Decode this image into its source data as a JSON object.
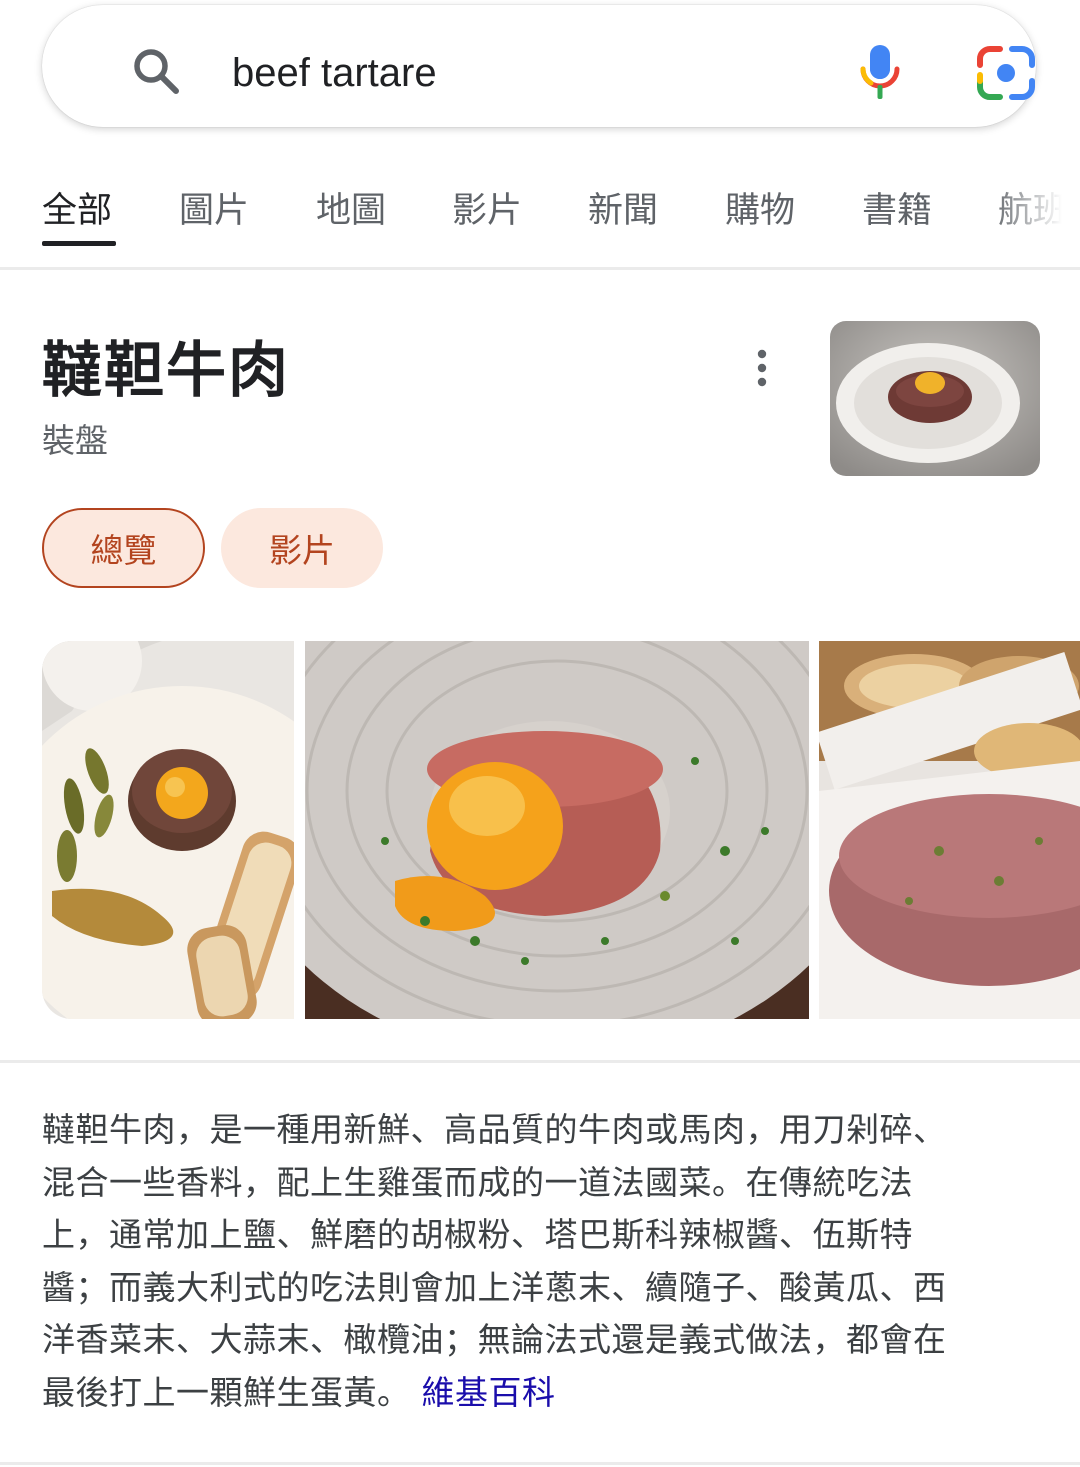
{
  "search": {
    "query": "beef tartare"
  },
  "tabs": [
    {
      "label": "全部",
      "active": true
    },
    {
      "label": "圖片"
    },
    {
      "label": "地圖"
    },
    {
      "label": "影片"
    },
    {
      "label": "新聞"
    },
    {
      "label": "購物"
    },
    {
      "label": "書籍"
    },
    {
      "label": "航班"
    }
  ],
  "knowledge_panel": {
    "title": "韃靼牛肉",
    "subtitle": "裝盤",
    "chips": [
      {
        "label": "總覽",
        "selected": true
      },
      {
        "label": "影片",
        "selected": false
      }
    ],
    "description_lines": [
      "韃靼牛肉，是一種用新鮮、高品質的牛肉或馬肉，用刀剁碎、",
      "混合一些香料，配上生雞蛋而成的一道法國菜。在傳統吃法",
      "上，通常加上鹽、鮮磨的胡椒粉、塔巴斯科辣椒醬、伍斯特",
      "醬；而義大利式的吃法則會加上洋蔥末、續隨子、酸黃瓜、西",
      "洋香菜末、大蒜末、橄欖油；無論法式還是義式做法，都會在",
      "最後打上一顆鮮生蛋黃。"
    ],
    "source_link": "維基百科"
  },
  "colors": {
    "chip_text": "#b3441f",
    "chip_bg": "#fce8de",
    "link": "#1a0dab"
  },
  "icons": [
    "search-icon",
    "microphone-icon",
    "google-lens-icon",
    "more-vert-icon"
  ]
}
